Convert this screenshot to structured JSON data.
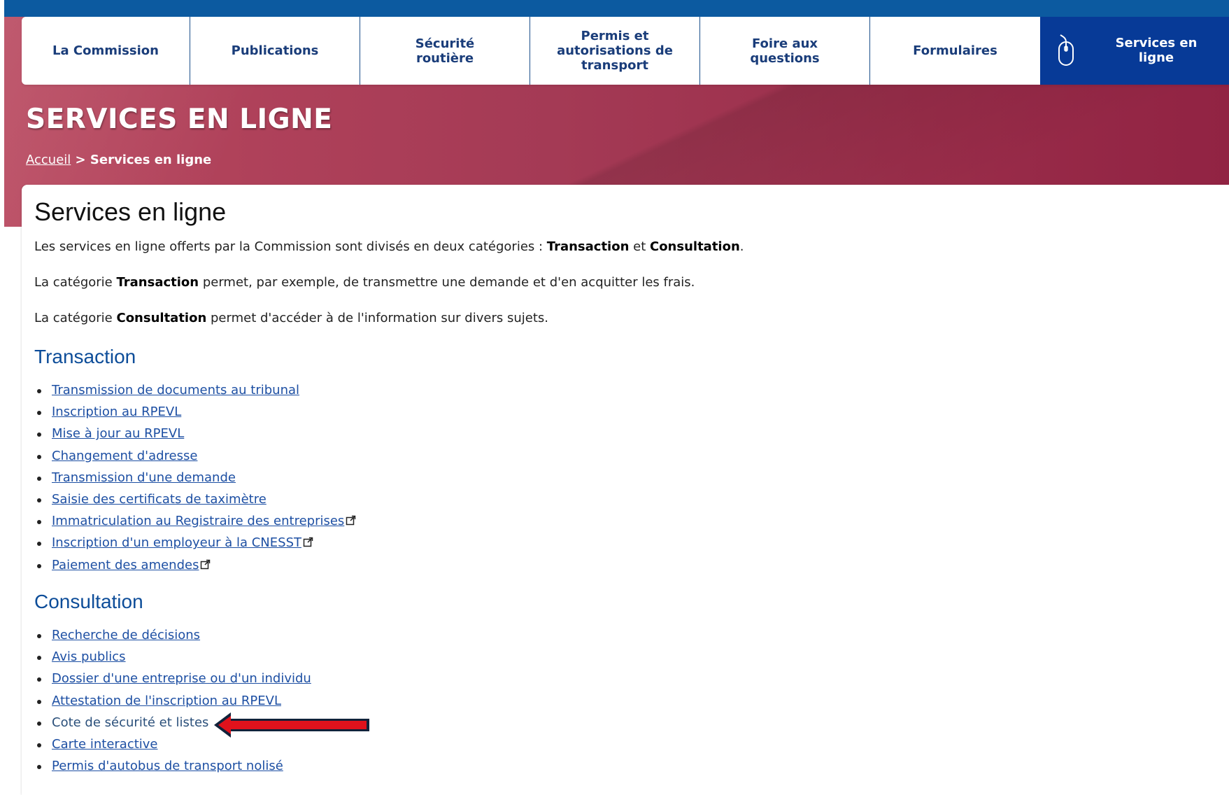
{
  "nav": {
    "items": [
      {
        "label": "La Commission"
      },
      {
        "label": "Publications"
      },
      {
        "label": "Sécurité routière"
      },
      {
        "label": "Permis et autorisations de transport"
      },
      {
        "label": "Foire aux questions"
      },
      {
        "label": "Formulaires"
      }
    ],
    "active_label": "Services en ligne",
    "active_icon": "mouse-icon"
  },
  "hero": {
    "title": "SERVICES EN LIGNE",
    "breadcrumb_home": "Accueil",
    "breadcrumb_separator": " > ",
    "breadcrumb_current": "Services en ligne"
  },
  "main": {
    "title": "Services en ligne",
    "intro": {
      "p1_before": "Les services en ligne offerts par la Commission sont divisés en deux catégories : ",
      "p1_bold1": "Transaction",
      "p1_mid": " et ",
      "p1_bold2": "Consultation",
      "p1_end": ".",
      "p2_before": "La catégorie ",
      "p2_bold": "Transaction",
      "p2_after": " permet, par exemple, de transmettre une demande et d'en acquitter les frais.",
      "p3_before": "La catégorie ",
      "p3_bold": "Consultation",
      "p3_after": " permet d'accéder à de l'information sur divers sujets."
    },
    "transaction": {
      "heading": "Transaction",
      "links": [
        "Transmission de documents au tribunal",
        "Inscription au RPEVL",
        "Mise à jour au RPEVL",
        "Changement d'adresse",
        "Transmission d'une demande",
        "Saisie des certificats de taximètre",
        "Immatriculation au Registraire des entreprises",
        "Inscription d'un employeur à la CNESST",
        "Paiement des amendes"
      ]
    },
    "consultation": {
      "heading": "Consultation",
      "links": [
        "Recherche de décisions",
        "Avis publics",
        "Dossier d'une entreprise ou d'un individu",
        "Attestation de l'inscription au RPEVL",
        "Cote de sécurité et listes",
        "Carte interactive",
        "Permis d'autobus de transport nolisé"
      ]
    }
  },
  "colors": {
    "top_bar": "#0c5aa0",
    "hero_red": "#a43a55",
    "nav_active_bg": "#073a97",
    "nav_text": "#1a3d7a",
    "link": "#1d4fa3",
    "section_heading": "#0d4d99",
    "arrow_red": "#e0121c"
  },
  "icons": {
    "external_link": "external-link-icon",
    "annotation_arrow": "red-arrow-annotation"
  }
}
